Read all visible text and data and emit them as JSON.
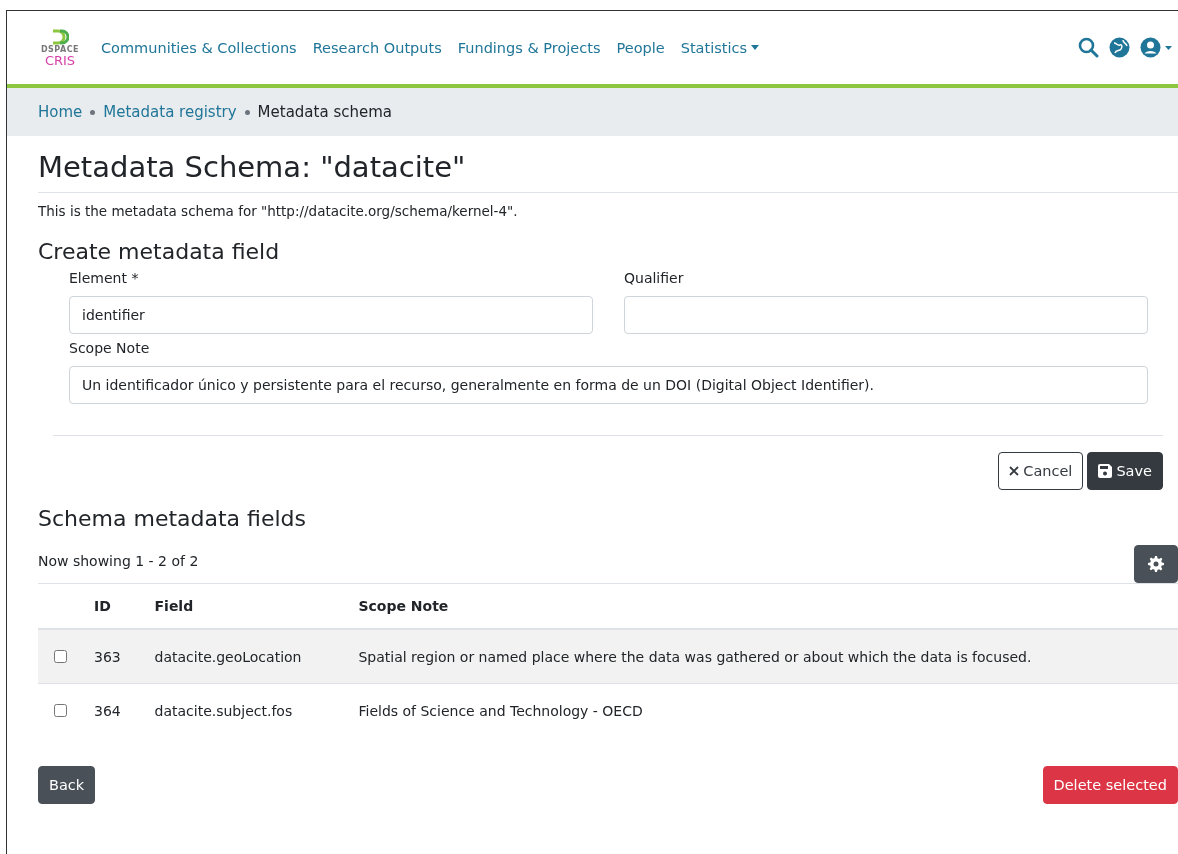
{
  "logo": {
    "top": "DSPACE",
    "bottom": "CRIS"
  },
  "nav": [
    {
      "label": "Communities & Collections",
      "dropdown": false
    },
    {
      "label": "Research Outputs",
      "dropdown": false
    },
    {
      "label": "Fundings & Projects",
      "dropdown": false
    },
    {
      "label": "People",
      "dropdown": false
    },
    {
      "label": "Statistics",
      "dropdown": true
    }
  ],
  "breadcrumbs": [
    {
      "label": "Home",
      "link": true
    },
    {
      "label": "Metadata registry",
      "link": true
    },
    {
      "label": "Metadata schema",
      "link": false
    }
  ],
  "title": "Metadata Schema: \"datacite\"",
  "description": "This is the metadata schema for \"http://datacite.org/schema/kernel-4\".",
  "form": {
    "title": "Create metadata field",
    "element": {
      "label": "Element *",
      "value": "identifier"
    },
    "qualifier": {
      "label": "Qualifier"
    },
    "scope_note": {
      "label": "Scope Note",
      "value": "Un identificador único y persistente para el recurso, generalmente en forma de un DOI (Digital Object Identifier)."
    },
    "buttons": {
      "cancel": "Cancel",
      "save": "Save"
    }
  },
  "fields": {
    "title": "Schema metadata fields",
    "showing": "Now showing 1 - 2 of 2",
    "columns": [
      "ID",
      "Field",
      "Scope Note"
    ],
    "rows": [
      {
        "checked": false,
        "id": "363",
        "field": "datacite.geoLocation",
        "scope_note": "Spatial region or named place where the data was gathered or about which the data is focused."
      },
      {
        "checked": false,
        "id": "364",
        "field": "datacite.subject.fos",
        "scope_note": "Fields of Science and Technology - OECD"
      }
    ]
  },
  "buttons": {
    "back": "Back",
    "delete": "Delete selected"
  }
}
